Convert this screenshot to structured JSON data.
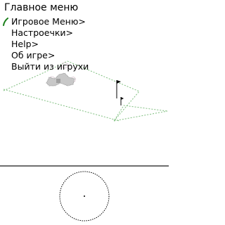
{
  "menu": {
    "title": "Главное меню",
    "items": [
      {
        "label": "Игровое Меню>"
      },
      {
        "label": "Настроечки>"
      },
      {
        "label": "Help>"
      },
      {
        "label": "Об игре>"
      },
      {
        "label": "Выйти из игрухи"
      }
    ],
    "selected_index": 0
  },
  "colors": {
    "background": "#ffffff",
    "text": "#000000",
    "track_outline": "#7fbf7f",
    "cursor": "#1a7f1a",
    "divider": "#6e6e6e"
  },
  "icons": {
    "cursor": "menu-selection-cursor",
    "flags": "goal-flag",
    "vehicle": "vehicle-sprite"
  }
}
